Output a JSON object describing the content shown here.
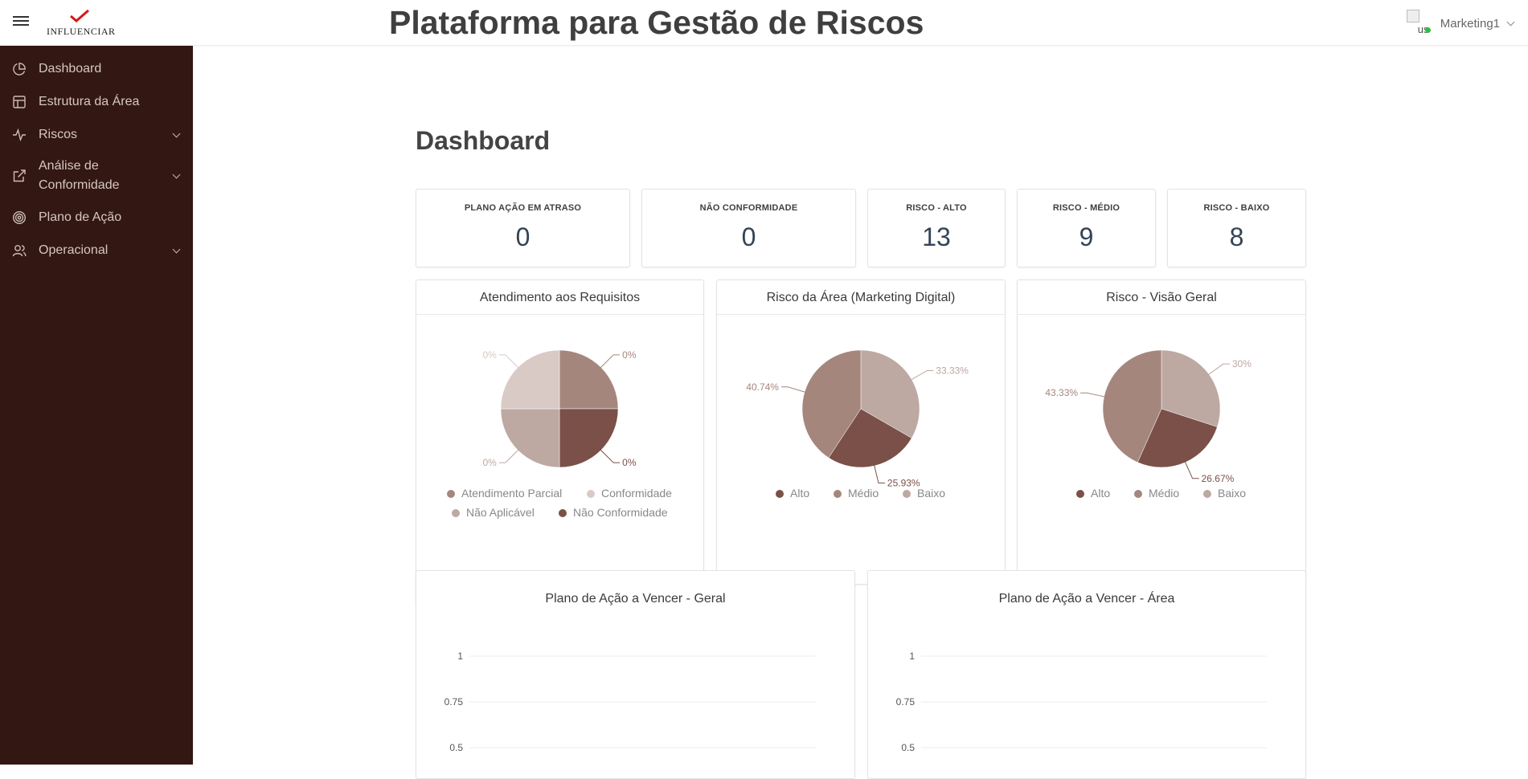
{
  "header": {
    "brand": "INFLUENCIAR",
    "title": "Plataforma para Gestão de Riscos",
    "user_alt": "us",
    "user_name": "Marketing1"
  },
  "sidebar": {
    "items": [
      {
        "label": "Dashboard",
        "icon": "pie-chart-icon",
        "expandable": false
      },
      {
        "label": "Estrutura da Área",
        "icon": "layout-icon",
        "expandable": false
      },
      {
        "label": "Riscos",
        "icon": "activity-icon",
        "expandable": true
      },
      {
        "label": "Análise de Conformidade",
        "icon": "external-link-icon",
        "expandable": true
      },
      {
        "label": "Plano de Ação",
        "icon": "target-icon",
        "expandable": false
      },
      {
        "label": "Operacional",
        "icon": "users-icon",
        "expandable": true
      }
    ]
  },
  "page": {
    "title": "Dashboard"
  },
  "stats": [
    {
      "label": "PLANO AÇÃO EM ATRASO",
      "value": "0"
    },
    {
      "label": "NÃO CONFORMIDADE",
      "value": "0"
    },
    {
      "label": "RISCO - ALTO",
      "value": "13"
    },
    {
      "label": "RISCO - MÉDIO",
      "value": "9"
    },
    {
      "label": "RISCO - BAIXO",
      "value": "8"
    }
  ],
  "colors": {
    "sidebar_bg": "#331712",
    "alto": "#7a5048",
    "medio": "#a5867d",
    "baixo": "#bda8a2",
    "atendimento_parcial": "#a5867d",
    "conformidade": "#d9cac6",
    "nao_aplicavel": "#bda8a2",
    "nao_conformidade": "#7a5048",
    "status_online": "#2fbf44"
  },
  "chart_data": [
    {
      "type": "pie",
      "title": "Atendimento aos Requisitos",
      "labels": [
        "Atendimento Parcial",
        "Conformidade",
        "Não Aplicável",
        "Não Conformidade"
      ],
      "values": [
        0,
        0,
        0,
        0
      ],
      "data_labels": [
        "0%",
        "0%",
        "0%",
        "0%"
      ],
      "legend": "bottom"
    },
    {
      "type": "pie",
      "title": "Risco da Área (Marketing Digital)",
      "labels": [
        "Alto",
        "Médio",
        "Baixo"
      ],
      "values": [
        25.93,
        40.74,
        33.33
      ],
      "data_labels": [
        "25.93%",
        "40.74%",
        "33.33%"
      ],
      "legend": "bottom"
    },
    {
      "type": "pie",
      "title": "Risco - Visão Geral",
      "labels": [
        "Alto",
        "Médio",
        "Baixo"
      ],
      "values": [
        26.67,
        43.33,
        30
      ],
      "data_labels": [
        "26.67%",
        "43.33%",
        "30%"
      ],
      "legend": "bottom"
    },
    {
      "type": "line",
      "title": "Plano de Ação a Vencer - Geral",
      "y_ticks": [
        "1",
        "0.75",
        "0.5"
      ],
      "series": [],
      "grid": true
    },
    {
      "type": "line",
      "title": "Plano de Ação a Vencer - Área",
      "y_ticks": [
        "1",
        "0.75",
        "0.5"
      ],
      "series": [],
      "grid": true
    }
  ]
}
